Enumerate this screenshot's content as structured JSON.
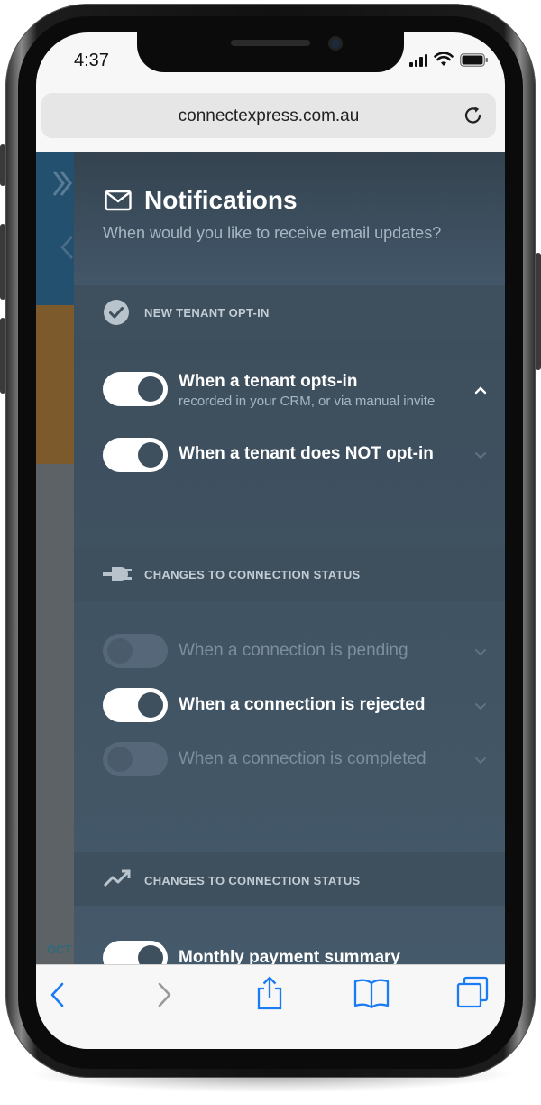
{
  "status_bar": {
    "time": "4:37"
  },
  "browser": {
    "url": "connectexpress.com.au"
  },
  "background_page": {
    "month_label": "OCT"
  },
  "notifications": {
    "title": "Notifications",
    "subtitle": "When would you like to receive email updates?",
    "sections": [
      {
        "label": "NEW TENANT OPT-IN",
        "icon": "check-circle-icon",
        "rows": [
          {
            "label": "When a tenant opts-in",
            "sub": "recorded in your CRM, or via manual invite",
            "enabled": true,
            "expanded": true
          },
          {
            "label": "When a tenant does NOT opt-in",
            "enabled": true,
            "expanded": false
          }
        ]
      },
      {
        "label": "CHANGES TO CONNECTION STATUS",
        "icon": "plug-icon",
        "rows": [
          {
            "label": "When a connection is pending",
            "enabled": false
          },
          {
            "label": "When a connection is rejected",
            "enabled": true
          },
          {
            "label": "When a connection is completed",
            "enabled": false
          }
        ]
      },
      {
        "label": "CHANGES TO CONNECTION STATUS",
        "icon": "trending-up-icon",
        "rows": [
          {
            "label": "Monthly payment summary",
            "enabled": true
          }
        ]
      }
    ]
  },
  "colors": {
    "panel": "#3f5362",
    "accent_white": "#ffffff",
    "dim_text": "#7d8e9c"
  }
}
